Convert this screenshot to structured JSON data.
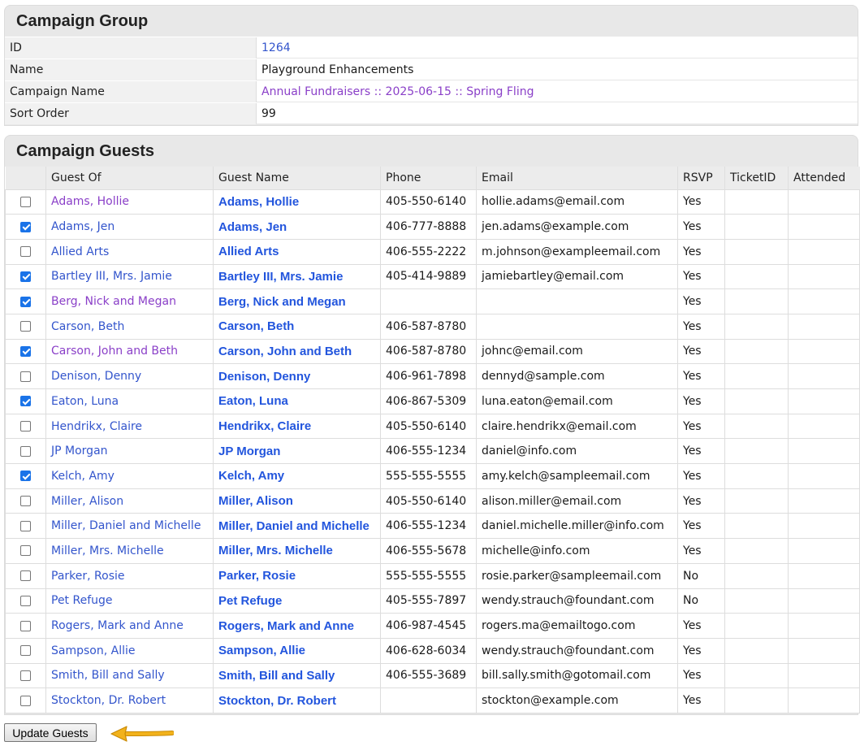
{
  "group": {
    "title": "Campaign Group",
    "rows": [
      {
        "label": "ID",
        "value": "1264",
        "color": "blue"
      },
      {
        "label": "Name",
        "value": "Playground Enhancements",
        "color": "plain"
      },
      {
        "label": "Campaign Name",
        "value": "Annual Fundraisers :: 2025-06-15 :: Spring Fling",
        "color": "purple"
      },
      {
        "label": "Sort Order",
        "value": "99",
        "color": "plain"
      }
    ]
  },
  "guests": {
    "title": "Campaign Guests",
    "columns": [
      "",
      "Guest Of",
      "Guest Name",
      "Phone",
      "Email",
      "RSVP",
      "TicketID",
      "Attended"
    ],
    "rows": [
      {
        "checked": false,
        "guest_of": "Adams, Hollie",
        "visited": true,
        "name": "Adams, Hollie",
        "phone": "405-550-6140",
        "email": "hollie.adams@email.com",
        "rsvp": "Yes",
        "ticket": "",
        "attended": ""
      },
      {
        "checked": true,
        "guest_of": "Adams, Jen",
        "visited": false,
        "name": "Adams, Jen",
        "phone": "406-777-8888",
        "email": "jen.adams@example.com",
        "rsvp": "Yes",
        "ticket": "",
        "attended": ""
      },
      {
        "checked": false,
        "guest_of": "Allied Arts",
        "visited": false,
        "name": "Allied Arts",
        "phone": "406-555-2222",
        "email": "m.johnson@exampleemail.com",
        "rsvp": "Yes",
        "ticket": "",
        "attended": ""
      },
      {
        "checked": true,
        "guest_of": "Bartley III, Mrs. Jamie",
        "visited": false,
        "name": "Bartley III, Mrs. Jamie",
        "phone": "405-414-9889",
        "email": "jamiebartley@email.com",
        "rsvp": "Yes",
        "ticket": "",
        "attended": ""
      },
      {
        "checked": true,
        "guest_of": "Berg, Nick and Megan",
        "visited": true,
        "name": "Berg, Nick and Megan",
        "phone": "",
        "email": "",
        "rsvp": "Yes",
        "ticket": "",
        "attended": ""
      },
      {
        "checked": false,
        "guest_of": "Carson, Beth",
        "visited": false,
        "name": "Carson, Beth",
        "phone": "406-587-8780",
        "email": "",
        "rsvp": "Yes",
        "ticket": "",
        "attended": ""
      },
      {
        "checked": true,
        "guest_of": "Carson, John and Beth",
        "visited": true,
        "name": "Carson, John and Beth",
        "phone": "406-587-8780",
        "email": "johnc@email.com",
        "rsvp": "Yes",
        "ticket": "",
        "attended": ""
      },
      {
        "checked": false,
        "guest_of": "Denison, Denny",
        "visited": false,
        "name": "Denison, Denny",
        "phone": "406-961-7898",
        "email": "dennyd@sample.com",
        "rsvp": "Yes",
        "ticket": "",
        "attended": ""
      },
      {
        "checked": true,
        "guest_of": "Eaton, Luna",
        "visited": false,
        "name": "Eaton, Luna",
        "phone": "406-867-5309",
        "email": "luna.eaton@email.com",
        "rsvp": "Yes",
        "ticket": "",
        "attended": ""
      },
      {
        "checked": false,
        "guest_of": "Hendrikx, Claire",
        "visited": false,
        "name": "Hendrikx, Claire",
        "phone": "405-550-6140",
        "email": "claire.hendrikx@email.com",
        "rsvp": "Yes",
        "ticket": "",
        "attended": ""
      },
      {
        "checked": false,
        "guest_of": "JP Morgan",
        "visited": false,
        "name": "JP Morgan",
        "phone": "406-555-1234",
        "email": "daniel@info.com",
        "rsvp": "Yes",
        "ticket": "",
        "attended": ""
      },
      {
        "checked": true,
        "guest_of": "Kelch, Amy",
        "visited": false,
        "name": "Kelch, Amy",
        "phone": "555-555-5555",
        "email": "amy.kelch@sampleemail.com",
        "rsvp": "Yes",
        "ticket": "",
        "attended": ""
      },
      {
        "checked": false,
        "guest_of": "Miller, Alison",
        "visited": false,
        "name": "Miller, Alison",
        "phone": "405-550-6140",
        "email": "alison.miller@email.com",
        "rsvp": "Yes",
        "ticket": "",
        "attended": ""
      },
      {
        "checked": false,
        "guest_of": "Miller, Daniel and Michelle",
        "visited": false,
        "name": "Miller, Daniel and Michelle",
        "phone": "406-555-1234",
        "email": "daniel.michelle.miller@info.com",
        "rsvp": "Yes",
        "ticket": "",
        "attended": ""
      },
      {
        "checked": false,
        "guest_of": "Miller, Mrs. Michelle",
        "visited": false,
        "name": "Miller, Mrs. Michelle",
        "phone": "406-555-5678",
        "email": "michelle@info.com",
        "rsvp": "Yes",
        "ticket": "",
        "attended": ""
      },
      {
        "checked": false,
        "guest_of": "Parker, Rosie",
        "visited": false,
        "name": "Parker, Rosie",
        "phone": "555-555-5555",
        "email": "rosie.parker@sampleemail.com",
        "rsvp": "No",
        "ticket": "",
        "attended": ""
      },
      {
        "checked": false,
        "guest_of": "Pet Refuge",
        "visited": false,
        "name": "Pet Refuge",
        "phone": "405-555-7897",
        "email": "wendy.strauch@foundant.com",
        "rsvp": "No",
        "ticket": "",
        "attended": ""
      },
      {
        "checked": false,
        "guest_of": "Rogers, Mark and Anne",
        "visited": false,
        "name": "Rogers, Mark and Anne",
        "phone": "406-987-4545",
        "email": "rogers.ma@emailtogo.com",
        "rsvp": "Yes",
        "ticket": "",
        "attended": ""
      },
      {
        "checked": false,
        "guest_of": "Sampson, Allie",
        "visited": false,
        "name": "Sampson, Allie",
        "phone": "406-628-6034",
        "email": "wendy.strauch@foundant.com",
        "rsvp": "Yes",
        "ticket": "",
        "attended": ""
      },
      {
        "checked": false,
        "guest_of": "Smith, Bill and Sally",
        "visited": false,
        "name": "Smith, Bill and Sally",
        "phone": "406-555-3689",
        "email": "bill.sally.smith@gotomail.com",
        "rsvp": "Yes",
        "ticket": "",
        "attended": ""
      },
      {
        "checked": false,
        "guest_of": "Stockton, Dr. Robert",
        "visited": false,
        "name": "Stockton, Dr. Robert",
        "phone": "",
        "email": "stockton@example.com",
        "rsvp": "Yes",
        "ticket": "",
        "attended": ""
      }
    ]
  },
  "footer": {
    "update_label": "Update Guests",
    "arrow_icon": "arrow-left-icon"
  },
  "colors": {
    "link_blue": "#3355cc",
    "visited_purple": "#8a3fc8",
    "name_blue": "#2255dd",
    "checkbox_blue": "#1a73e8",
    "arrow_orange": "#f2b21b"
  }
}
